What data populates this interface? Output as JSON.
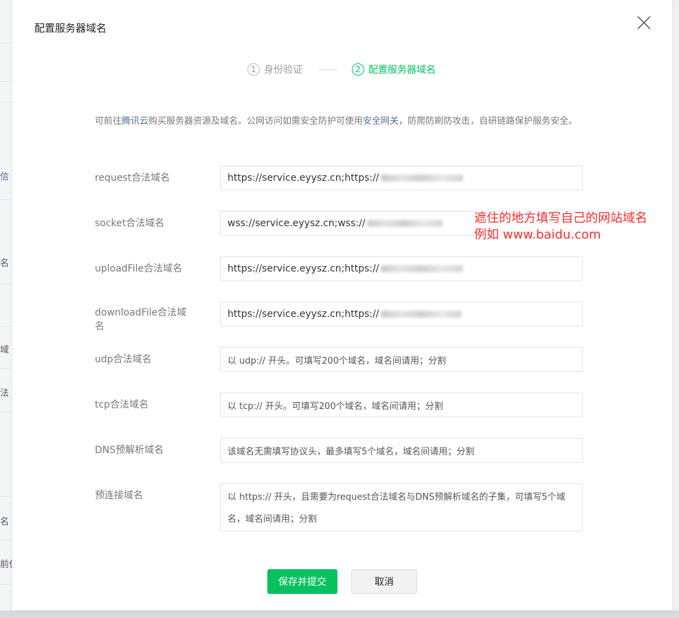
{
  "background": {
    "fragments": [
      "信",
      "名",
      "域",
      "法",
      "名",
      "前仅"
    ]
  },
  "dialog": {
    "title": "配置服务器域名",
    "close_icon": "close-icon"
  },
  "steps": [
    {
      "num": "1",
      "label": "身份验证"
    },
    {
      "num": "2",
      "label": "配置服务器域名"
    }
  ],
  "intro": {
    "prefix": "可前往",
    "tencent_link": "腾讯云",
    "middle": "购买服务器资源及域名。公网访问如需安全防护可使用",
    "gateway_link": "安全网关",
    "suffix": "，防爬防刷防攻击，自研链路保护服务安全。"
  },
  "fields": {
    "request": {
      "label": "request合法域名",
      "value": "https://service.eyysz.cn;https://"
    },
    "socket": {
      "label": "socket合法域名",
      "value": "wss://service.eyysz.cn;wss://"
    },
    "upload": {
      "label": "uploadFile合法域名",
      "value": "https://service.eyysz.cn;https://"
    },
    "download": {
      "label": "downloadFile合法域名",
      "value": "https://service.eyysz.cn;https://"
    },
    "udp": {
      "label": "udp合法域名",
      "placeholder": "以 udp:// 开头。可填写200个域名，域名间请用；分割"
    },
    "tcp": {
      "label": "tcp合法域名",
      "placeholder": "以 tcp:// 开头。可填写200个域名，域名间请用；分割"
    },
    "dns": {
      "label": "DNS预解析域名",
      "placeholder": "该域名无需填写协议头，最多填写5个域名，域名间请用；分割"
    },
    "preconnect": {
      "label": "预连接域名",
      "placeholder": "以 https:// 开头，且需要为request合法域名与DNS预解析域名的子集，可填写5个域名，域名间请用；分割"
    }
  },
  "annotation": {
    "line1": "遮住的地方填写自己的网站域名",
    "line2": "例如  www.baidu.com"
  },
  "buttons": {
    "save": "保存并提交",
    "cancel": "取消"
  },
  "colors": {
    "accent": "#07c160",
    "link": "#576b95",
    "annotation": "#ff2a2a"
  }
}
